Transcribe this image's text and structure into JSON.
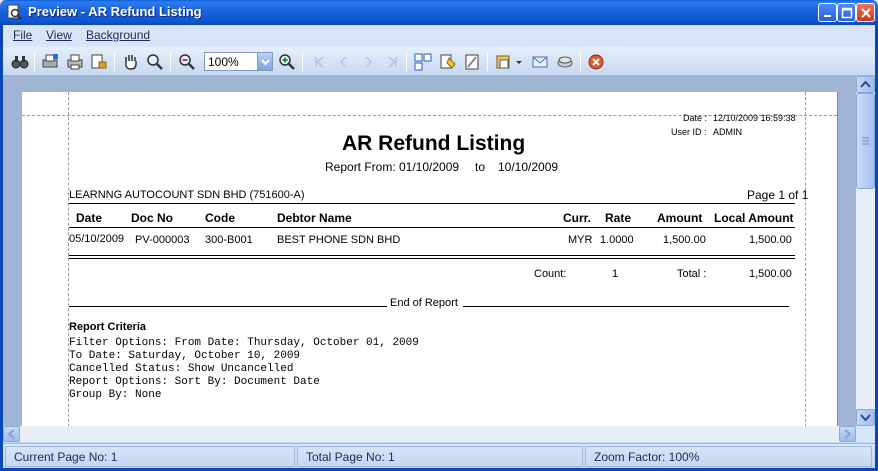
{
  "window": {
    "title": "Preview - AR Refund Listing",
    "colors": {
      "titlebar": "#1a64e0",
      "preview_bg": "#a0b4d3",
      "close_btn": "#c63b1d"
    }
  },
  "menu": [
    {
      "label": "File"
    },
    {
      "label": "View"
    },
    {
      "label": "Background"
    }
  ],
  "toolbar": {
    "zoom_value": "100%",
    "icons": [
      "find-icon",
      "print-setup-icon",
      "print-icon",
      "export-icon",
      "hand-icon",
      "magnifier-icon",
      "zoom-out-icon",
      "zoom-in-icon",
      "first-page-icon",
      "prev-page-icon",
      "next-page-icon",
      "last-page-icon",
      "multi-page-icon",
      "page-color-icon",
      "watermark-icon",
      "save-icon",
      "email-icon",
      "send-icon",
      "close-preview-icon"
    ]
  },
  "report": {
    "date_label": "Date :",
    "date_value": "12/10/2009 16:59:38",
    "user_label": "User ID :",
    "user_value": "ADMIN",
    "title": "AR Refund Listing",
    "from_label": "Report From:",
    "from_date": "01/10/2009",
    "to_label": "to",
    "to_date": "10/10/2009",
    "company": "LEARNNG AUTOCOUNT SDN BHD (751600-A)",
    "page_info": "Page 1 of 1",
    "columns": {
      "date": "Date",
      "doc_no": "Doc No",
      "code": "Code",
      "debtor_name": "Debtor Name",
      "curr": "Curr.",
      "rate": "Rate",
      "amount": "Amount",
      "local_amount": "Local Amount"
    },
    "rows": [
      {
        "date": "05/10/2009",
        "doc_no": "PV-000003",
        "code": "300-B001",
        "debtor_name": "BEST PHONE SDN BHD",
        "curr": "MYR",
        "rate": "1.0000",
        "amount": "1,500.00",
        "local_amount": "1,500.00"
      }
    ],
    "count_label": "Count:",
    "count_value": "1",
    "total_label": "Total :",
    "total_value": "1,500.00",
    "end_label": "End of Report",
    "criteria_title": "Report Criteria",
    "criteria_lines": [
      "Filter Options: From Date: Thursday, October 01, 2009",
      "                To Date: Saturday, October 10, 2009",
      "                Cancelled Status: Show Uncancelled",
      "Report Options: Sort By: Document Date",
      "                Group By: None"
    ]
  },
  "status": {
    "current_page": "Current Page No: 1",
    "total_page": "Total Page No: 1",
    "zoom": "Zoom Factor: 100%"
  }
}
